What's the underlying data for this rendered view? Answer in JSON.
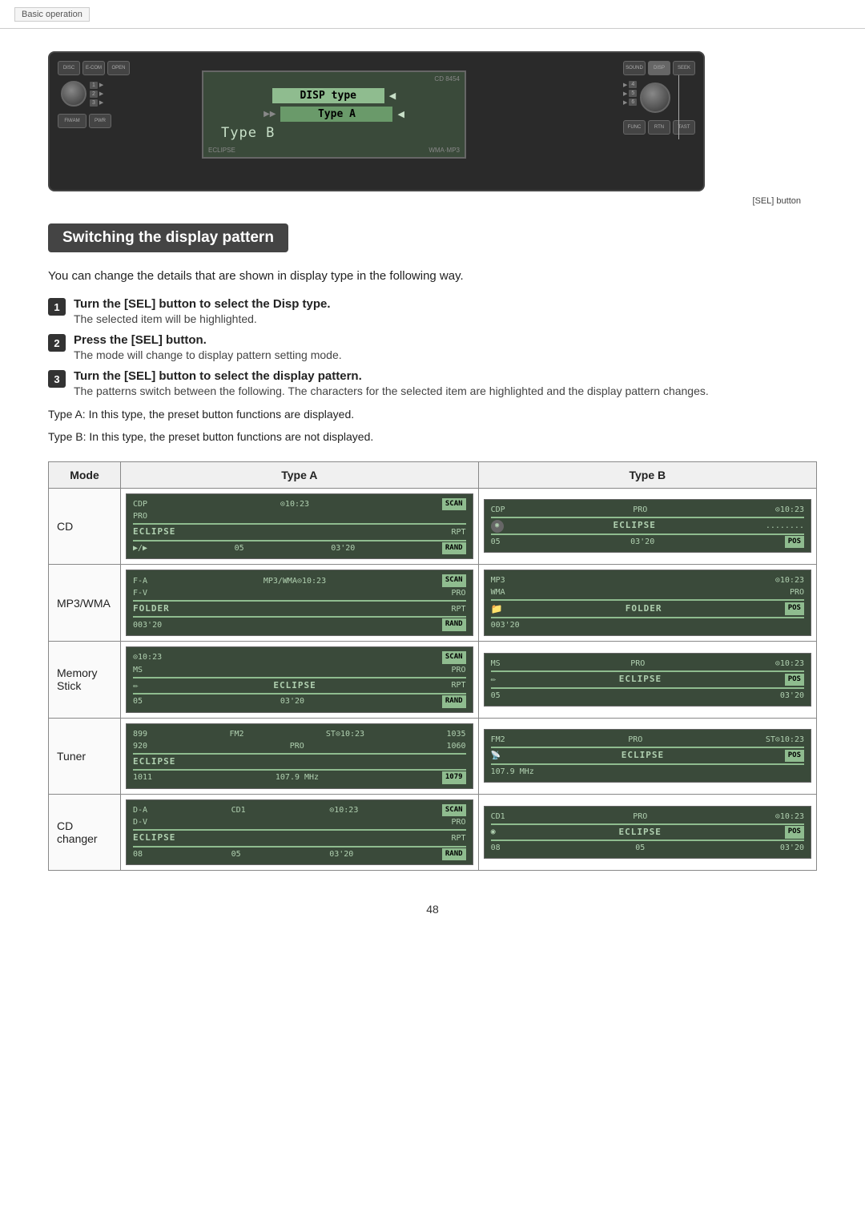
{
  "breadcrumb": {
    "text": "Basic operation"
  },
  "device": {
    "sel_button_label": "[SEL] button",
    "screen": {
      "row1_label": "DISP type",
      "row2_label": "Type A",
      "row3_label": "Type B"
    }
  },
  "section": {
    "title": "Switching the display pattern"
  },
  "intro": {
    "text": "You can change the details that are shown in display type in the following way."
  },
  "steps": [
    {
      "num": "1",
      "title": "Turn the [SEL] button to select the Disp type.",
      "desc": "The selected item will be highlighted."
    },
    {
      "num": "2",
      "title": "Press the [SEL] button.",
      "desc": "The mode will change to display pattern setting mode."
    },
    {
      "num": "3",
      "title": "Turn the [SEL] button to select the display pattern.",
      "desc": "The patterns switch between the following. The characters for the selected item are highlighted and the display pattern changes."
    }
  ],
  "type_descs": [
    "Type A: In this type, the preset button functions are displayed.",
    "Type B: In this type, the preset button functions are not displayed."
  ],
  "table": {
    "headers": [
      "Mode",
      "Type A",
      "Type B"
    ],
    "rows": [
      {
        "mode": "CD",
        "typeA": {
          "line1": "CDP  ⊙10:23 SCAN",
          "line2": "PRO",
          "line3": "ECLIPSE ......... RPT",
          "line4": "▶/▶  05  03'20 RAND"
        },
        "typeB": {
          "line1": "CDP  PRO  ⊙10:23",
          "line2": "ECLIPSE .........",
          "line3": "05  03'20"
        }
      },
      {
        "mode": "MP3/WMA",
        "typeA": {
          "line1": "F-A  MP3/WMA⊙10:23 SCAN",
          "line2": "F-V  PRO",
          "line3": "FOLDER ........... RPT",
          "line4": "003'20 RAND"
        },
        "typeB": {
          "line1": "MP3  ⊙10:23",
          "line2": "WMA PRO",
          "line3": "FOLDER  POS",
          "line4": "003'20"
        }
      },
      {
        "mode": "Memory Stick",
        "typeA": {
          "line1": "⊙10:23 SCAN",
          "line2": "MS  PRO",
          "line3": "ECLIPSE ......... RPT",
          "line4": "05  03'20 RAND"
        },
        "typeB": {
          "line1": "MS  PRO  ⊙10:23",
          "line2": "ECLIPSE ......... POS",
          "line3": "05  03'20"
        }
      },
      {
        "mode": "Tuner",
        "typeA": {
          "line1": "899  FM2  ST⊙10:23  1035",
          "line2": "920  PRO       1060",
          "line3": "ECLIPSE",
          "line4": "1011  107.9 MHz  1079"
        },
        "typeB": {
          "line1": "FM2  PRO  ST⊙10:23",
          "line2": "ECLIPSE  POS",
          "line3": "107.9 MHz"
        }
      },
      {
        "mode": "CD changer",
        "typeA": {
          "line1": "D-A  CD1  ⊙10:23 SCAN",
          "line2": "D-V  PRO",
          "line3": "ECLIPSE ......... RPT",
          "line4": "08  05  03'20 RAND"
        },
        "typeB": {
          "line1": "CD1  PRO  ⊙10:23",
          "line2": "ECLIPSE ......... POS",
          "line3": "08  05  03'20"
        }
      }
    ]
  },
  "page_number": "48"
}
